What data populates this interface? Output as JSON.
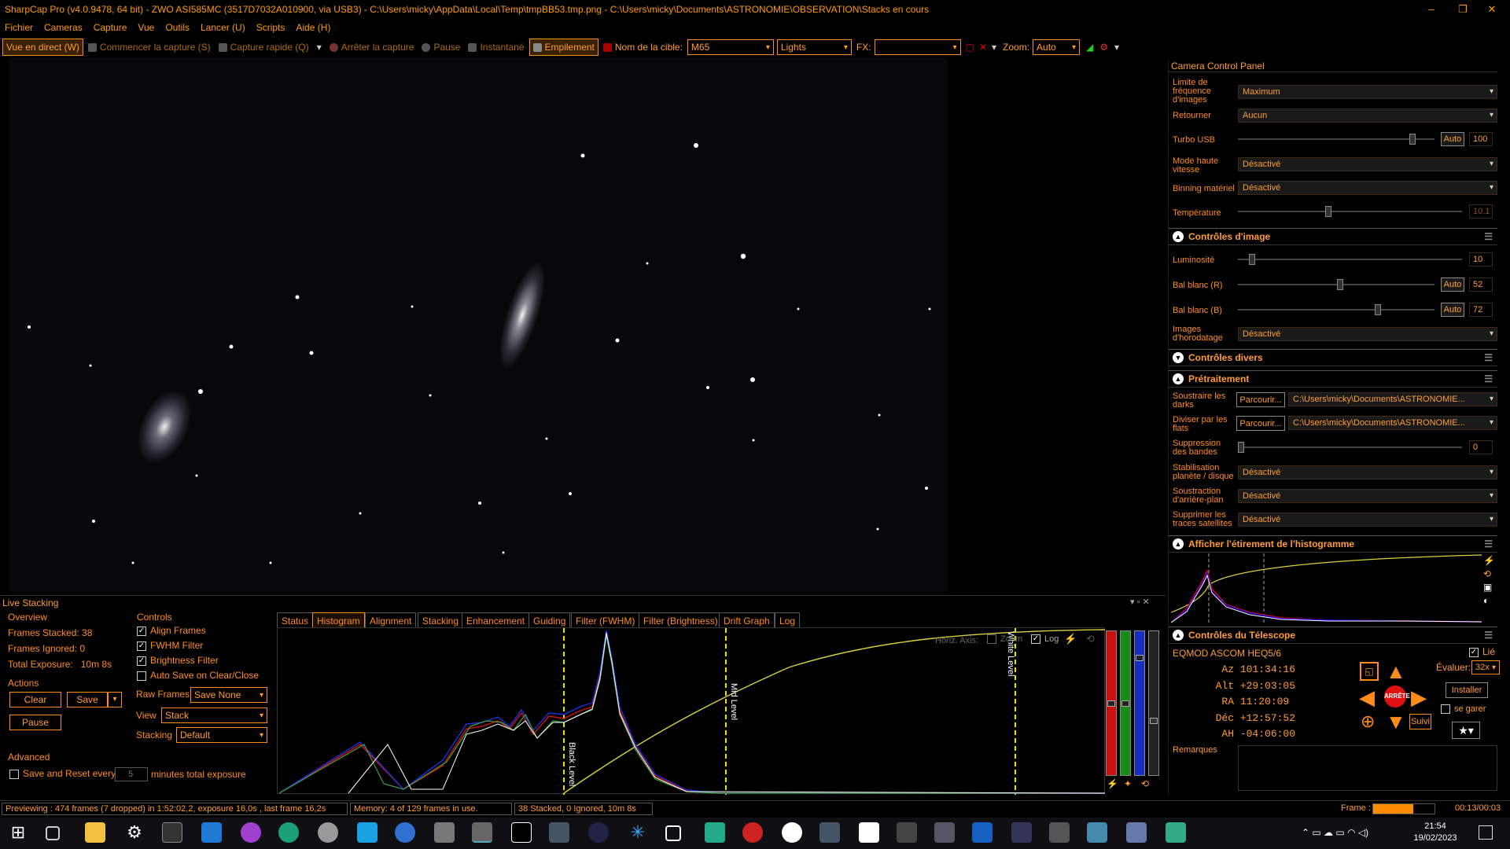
{
  "window": {
    "title": "SharpCap Pro (v4.0.9478, 64 bit) - ZWO ASI585MC (3517D7032A010900, via USB3) - C:\\Users\\micky\\AppData\\Local\\Temp\\tmpBB53.tmp.png - C:\\Users\\micky\\Documents\\ASTRONOMIE\\OBSERVATION\\Stacks en cours",
    "minimize": "–",
    "restore": "❐",
    "close": "✕"
  },
  "menu": [
    "Fichier",
    "Cameras",
    "Capture",
    "Vue",
    "Outils",
    "Lancer (U)",
    "Scripts",
    "Aide (H)"
  ],
  "toolbar": {
    "live_view": "Vue en direct (W)",
    "start_capture": "Commencer la capture (S)",
    "quick_capture": "Capture rapide (Q)",
    "stop_capture": "Arrêter la capture",
    "pause": "Pause",
    "snapshot": "Instantané",
    "stacking": "Empilement",
    "target_label": "Nom de la cible:",
    "target_value": "M65",
    "frame_type": "Lights",
    "fx_label": "FX:",
    "fx_value": "",
    "zoom_label": "Zoom:",
    "zoom_value": "Auto"
  },
  "camera_panel": {
    "title": "Camera Control Panel",
    "rows": {
      "frame_rate_label": "Limite de fréquence d'images",
      "frame_rate_value": "Maximum",
      "flip_label": "Retourner",
      "flip_value": "Aucun",
      "turbo_label": "Turbo USB",
      "turbo_auto": "Auto",
      "turbo_value": "100",
      "turbo_level": 0.9,
      "hispeed_label": "Mode haute vitesse",
      "hispeed_value": "Désactivé",
      "binning_label": "Binning matériel",
      "binning_value": "Désactivé",
      "temp_label": "Température",
      "temp_value": "10.1",
      "temp_level": 0.4
    },
    "image_controls": {
      "header": "Contrôles d'image",
      "brightness_label": "Luminosité",
      "brightness_value": "10",
      "brightness_level": 0.05,
      "wb_r_label": "Bal blanc (R)",
      "wb_r_auto": "Auto",
      "wb_r_value": "52",
      "wb_r_level": 0.52,
      "wb_b_label": "Bal blanc (B)",
      "wb_b_auto": "Auto",
      "wb_b_value": "72",
      "wb_b_level": 0.72,
      "timestamp_label": "Images d'horodatage",
      "timestamp_value": "Désactivé"
    },
    "misc_header": "Contrôles divers",
    "preprocessing": {
      "header": "Prétraitement",
      "darks_label": "Soustraire les darks",
      "darks_button": "Parcourir...",
      "darks_path": "C:\\Users\\micky\\Documents\\ASTRONOMIE...",
      "flats_label": "Diviser par les flats",
      "flats_button": "Parcourir...",
      "flats_path": "C:\\Users\\micky\\Documents\\ASTRONOMIE...",
      "banding_label": "Suppression des bandes",
      "banding_value": "0",
      "stabilisation_label": "Stabilisation planète / disque",
      "stabilisation_value": "Désactivé",
      "background_label": "Soustraction d'arrière-plan",
      "background_value": "Désactivé",
      "satellite_label": "Supprimer les traces satellites",
      "satellite_value": "Désactivé"
    },
    "histogram_header": "Afficher l'étirement de l'histogramme",
    "telescope": {
      "header": "Contrôles du Télescope",
      "mount": "EQMOD ASCOM HEQ5/6",
      "linked_label": "Lié",
      "az_label": "Az",
      "az_value": "101:34:16",
      "alt_label": "Alt",
      "alt_value": "+29:03:05",
      "ra_label": "RA",
      "ra_value": "11:20:09",
      "dec_label": "Déc",
      "dec_value": "+12:57:52",
      "ah_label": "AH",
      "ah_value": "-04:06:00",
      "stop": "ARRÊTE",
      "rate_label": "Évaluer:",
      "rate_value": "32x",
      "install": "Installer",
      "park": "se garer",
      "track": "Suivi",
      "notes_label": "Remarques"
    }
  },
  "live_stacking": {
    "title": "Live Stacking",
    "overview_header": "Overview",
    "frames_stacked": "Frames Stacked: 38",
    "frames_ignored": "Frames Ignored: 0",
    "total_exposure_label": "Total Exposure:",
    "total_exposure_value": "10m 8s",
    "actions_header": "Actions",
    "clear": "Clear",
    "save": "Save",
    "pause": "Pause",
    "advanced_header": "Advanced",
    "save_reset_label": "Save and Reset every",
    "save_reset_value": "5",
    "save_reset_suffix": "minutes total exposure",
    "controls_header": "Controls",
    "align_frames": "Align Frames",
    "fwhm_filter": "FWHM Filter",
    "brightness_filter": "Brightness Filter",
    "auto_save": "Auto Save on Clear/Close",
    "raw_frames_label": "Raw Frames",
    "raw_frames_value": "Save None",
    "view_label": "View",
    "view_value": "Stack",
    "stacking_label": "Stacking",
    "stacking_value": "Default",
    "tabs": [
      "Status",
      "Histogram",
      "Alignment",
      "Stacking",
      "Enhancement",
      "Guiding",
      "Filter (FWHM)",
      "Filter (Brightness)",
      "Drift Graph",
      "Log"
    ],
    "histogram": {
      "horiz_axis": "Horiz. Axis:",
      "zoom": "Zoom",
      "log": "Log",
      "black_level": "Black Level",
      "mid_level": "Mid Level",
      "white_level": "White Level"
    }
  },
  "status": {
    "previewing": "Previewing : 474 frames (7 dropped) in 1:52:02,2, exposure 16,0s , last frame 16,2s",
    "memory": "Memory: 4 of 129 frames in use.",
    "stacked": "38 Stacked, 0 Ignored, 10m 8s",
    "frame_label": "Frame :",
    "frame_time": "00:13/00:03",
    "frame_progress": 0.65
  },
  "taskbar": {
    "time": "21:54",
    "date": "19/02/2023"
  }
}
